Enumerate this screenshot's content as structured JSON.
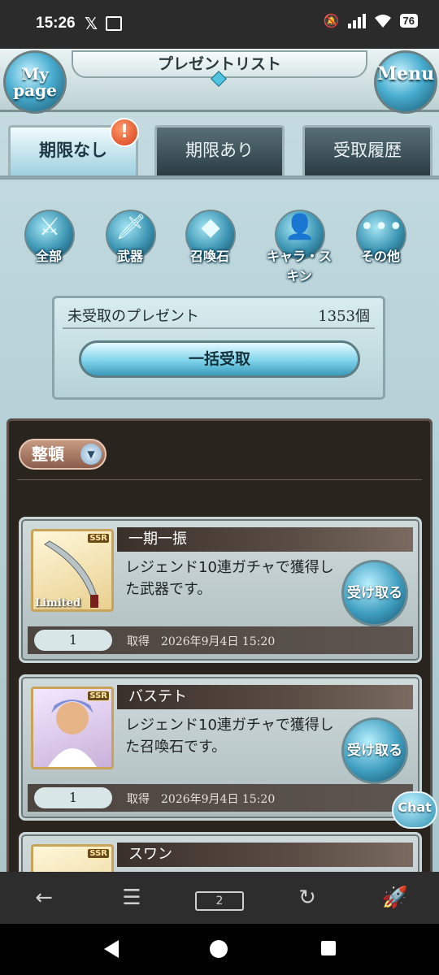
{
  "status": {
    "time": "15:26",
    "battery": "76"
  },
  "header": {
    "title": "プレゼントリスト",
    "left_button": "My page",
    "left_line1": "My",
    "left_line2": "page",
    "right_button": "Menu"
  },
  "tabs": [
    {
      "label": "期限なし",
      "active": true,
      "alert": "!"
    },
    {
      "label": "期限あり",
      "active": false
    },
    {
      "label": "受取履歴",
      "active": false
    }
  ],
  "filters": [
    {
      "label": "全部",
      "icon": "all-items-icon",
      "glyph": "⚔"
    },
    {
      "label": "武器",
      "icon": "sword-icon",
      "glyph": "🗡"
    },
    {
      "label": "召喚石",
      "icon": "crystal-icon",
      "glyph": "◆"
    },
    {
      "label": "キャラ・スキン",
      "icon": "character-icon",
      "glyph": "👤"
    },
    {
      "label": "その他",
      "icon": "more-dots-icon",
      "glyph": "•••"
    }
  ],
  "unclaimed": {
    "label": "未受取のプレゼント",
    "count": "1353個",
    "claim_all": "一括受取"
  },
  "sort_label": "整頓",
  "items": [
    {
      "name": "一期一振",
      "rarity": "SSR",
      "tag": "Limited",
      "desc": "レジェンド10連ガチャで獲得した武器です。",
      "claim": "受け取る",
      "qty": "1",
      "acquired": "取得　2026年9月4日 15:20"
    },
    {
      "name": "バステト",
      "rarity": "SSR",
      "desc": "レジェンド10連ガチャで獲得した召喚石です。",
      "claim": "受け取る",
      "qty": "1",
      "acquired": "取得　2026年9月4日 15:20"
    },
    {
      "name": "スワン",
      "rarity": "SSR"
    }
  ],
  "chat_label": "Chat",
  "colors": {
    "accent": "#3f9ec0",
    "panel_dark": "#2a241f",
    "alert": "#d63b16"
  }
}
